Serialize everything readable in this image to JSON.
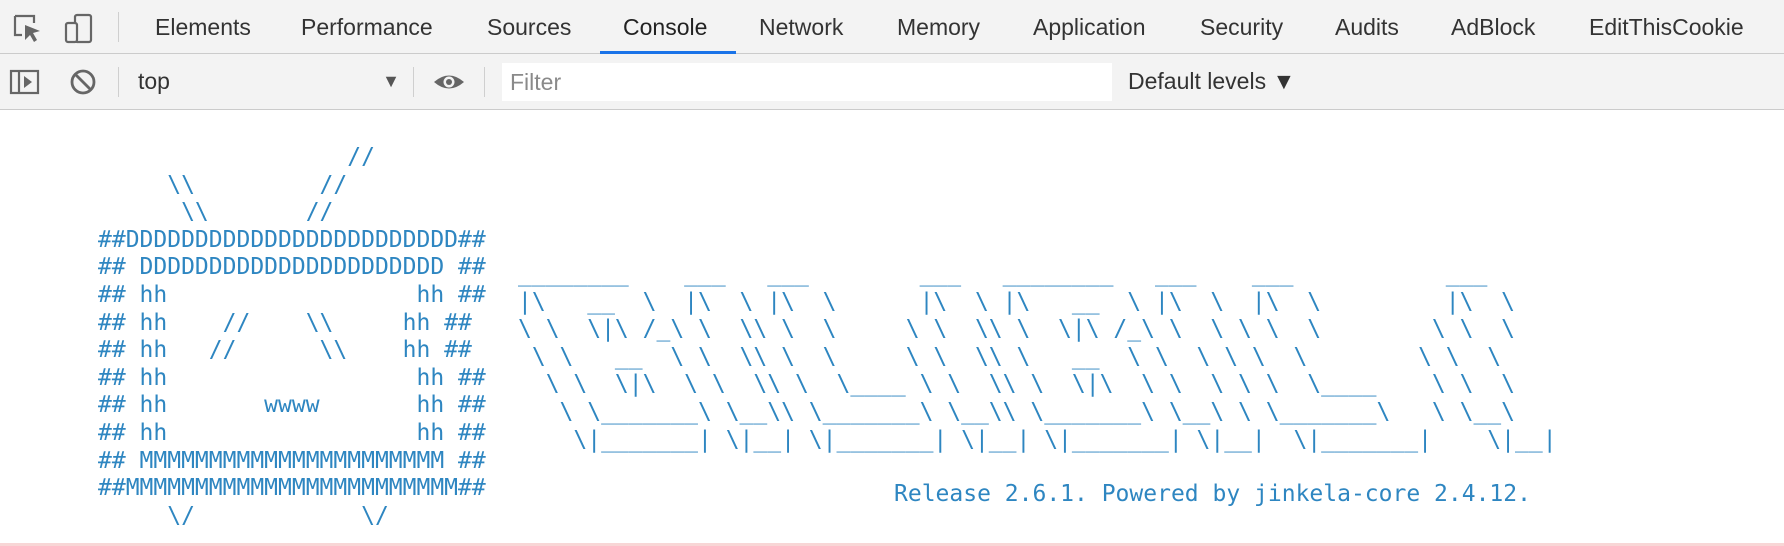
{
  "tabs": [
    {
      "label": "Elements",
      "active": false
    },
    {
      "label": "Performance",
      "active": false
    },
    {
      "label": "Sources",
      "active": false
    },
    {
      "label": "Console",
      "active": true
    },
    {
      "label": "Network",
      "active": false
    },
    {
      "label": "Memory",
      "active": false
    },
    {
      "label": "Application",
      "active": false
    },
    {
      "label": "Security",
      "active": false
    },
    {
      "label": "Audits",
      "active": false
    },
    {
      "label": "AdBlock",
      "active": false
    },
    {
      "label": "EditThisCookie",
      "active": false
    }
  ],
  "toolbar": {
    "context": "top",
    "filter_placeholder": "Filter",
    "filter_value": "",
    "levels": "Default levels ▼"
  },
  "console": {
    "ascii_left": "                  //\n     \\\\         //\n      \\\\       //\n##DDDDDDDDDDDDDDDDDDDDDDDD##\n## DDDDDDDDDDDDDDDDDDDDDD ##\n## hh                  hh ##\n## hh    //    \\\\     hh ##\n## hh   //      \\\\    hh ##\n## hh                  hh ##\n## hh       wwww       hh ##\n## hh                  hh ##\n## MMMMMMMMMMMMMMMMMMMMMM ##\n##MMMMMMMMMMMMMMMMMMMMMMMM##\n     \\/            \\/",
    "ascii_right": "________    ___   ___        ___   ________   ___    ___           ___\n|\\   __  \\  |\\  \\ |\\  \\      |\\  \\ |\\   __  \\ |\\  \\  |\\  \\         |\\  \\\n\\ \\  \\|\\ /_\\ \\  \\\\ \\  \\     \\ \\  \\\\ \\  \\|\\ /_\\ \\  \\ \\ \\  \\        \\ \\  \\\n \\ \\   __  \\ \\  \\\\ \\  \\     \\ \\  \\\\ \\   __  \\ \\  \\ \\ \\  \\        \\ \\  \\\n  \\ \\  \\|\\  \\ \\  \\\\ \\  \\____ \\ \\  \\\\ \\  \\|\\  \\ \\  \\ \\ \\  \\____    \\ \\  \\\n   \\ \\_______\\ \\__\\\\ \\_______\\ \\__\\\\ \\_______\\ \\__\\ \\ \\_______\\   \\ \\__\\\n    \\|_______| \\|__| \\|_______| \\|__| \\|_______| \\|__|  \\|_______|    \\|__|",
    "release_text": "Release 2.6.1. Powered by jinkela-core 2.4.12."
  },
  "colors": {
    "accent": "#1a73e8",
    "ascii": "#2e86c1",
    "bar_bg": "#f3f3f3"
  },
  "icons": [
    "inspect-element-icon",
    "device-toolbar-icon",
    "sidebar-toggle-icon",
    "clear-console-icon",
    "live-expression-eye-icon"
  ]
}
